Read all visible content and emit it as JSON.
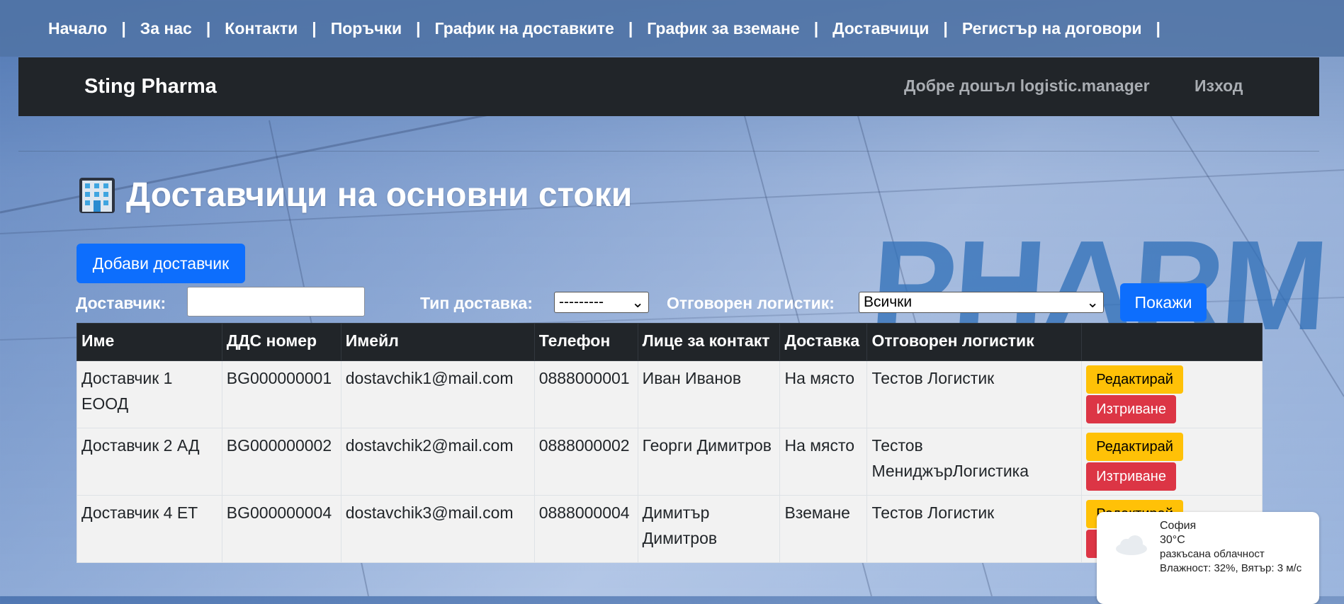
{
  "nav": {
    "items": [
      "Начало",
      "За нас",
      "Контакти",
      "Поръчки",
      "График на доставките",
      "График за вземане",
      "Доставчици",
      "Регистър на договори"
    ],
    "separator": "|"
  },
  "header": {
    "brand": "Sting Pharma",
    "welcome": "Добре дошъл logistic.manager",
    "logout": "Изход"
  },
  "background_text": "PHARM",
  "page": {
    "title": "Доставчици на основни стоки",
    "add_button": "Добави доставчик"
  },
  "filters": {
    "supplier_label": "Доставчик:",
    "supplier_value": "",
    "delivery_type_label": "Тип доставка:",
    "delivery_type_value": "---------",
    "logistician_label": "Отговорен логистик:",
    "logistician_value": "Всички",
    "show_button": "Покажи"
  },
  "table": {
    "headers": [
      "Име",
      "ДДС номер",
      "Имейл",
      "Телефон",
      "Лице за контакт",
      "Доставка",
      "Отговорен логистик",
      ""
    ],
    "rows": [
      {
        "name": "Доставчик 1 ЕООД",
        "vat": "BG000000001",
        "email": "dostavchik1@mail.com",
        "phone": "0888000001",
        "contact": "Иван Иванов",
        "delivery": "На място",
        "logistician": "Тестов Логистик"
      },
      {
        "name": "Доставчик 2 АД",
        "vat": "BG000000002",
        "email": "dostavchik2@mail.com",
        "phone": "0888000002",
        "contact": "Георги Димитров",
        "delivery": "На място",
        "logistician": "Тестов МениджърЛогистика"
      },
      {
        "name": "Доставчик 4 ЕТ",
        "vat": "BG000000004",
        "email": "dostavchik3@mail.com",
        "phone": "0888000004",
        "contact": "Димитър Димитров",
        "delivery": "Вземане",
        "logistician": "Тестов Логистик"
      }
    ],
    "edit_label": "Редактирай",
    "delete_label": "Изтриване"
  },
  "weather": {
    "city": "София",
    "temp": "30°C",
    "condition": "разкъсана облачност",
    "details": "Влажност: 32%, Вятър: 3 м/с",
    "icon": "cloud-icon"
  },
  "colors": {
    "primary": "#0d6efd",
    "warning": "#ffc107",
    "danger": "#dc3545",
    "dark": "#212529"
  }
}
